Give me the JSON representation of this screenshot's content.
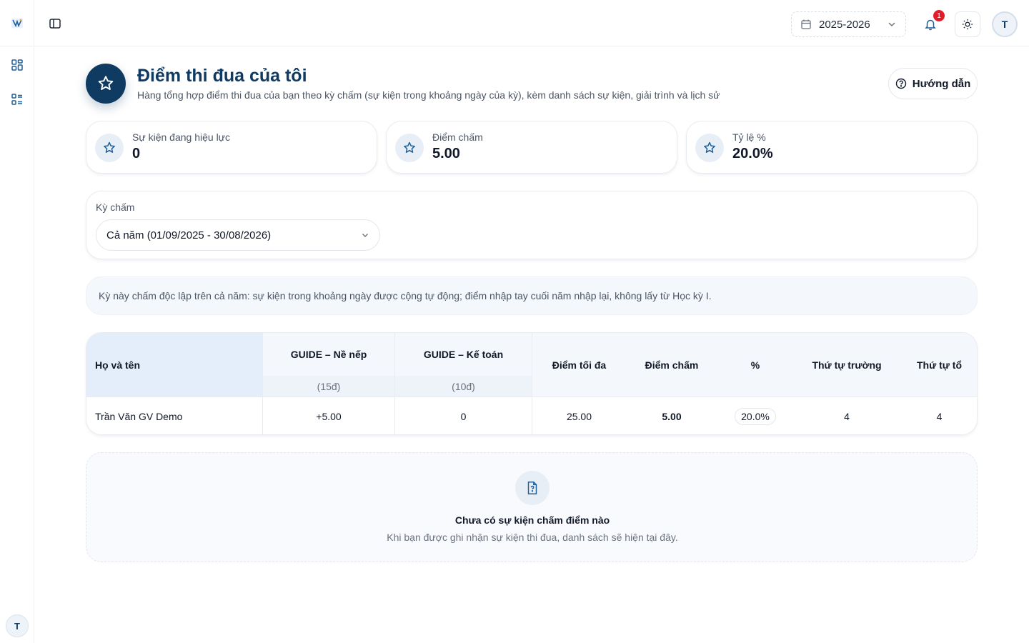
{
  "header": {
    "school_year": "2025-2026",
    "notification_count": "1",
    "user_initial": "T"
  },
  "sidebar": {
    "user_initial": "T",
    "icons": [
      "app-logo-icon",
      "dashboard-grid-icon",
      "list-icon"
    ]
  },
  "page": {
    "title": "Điểm thi đua của tôi",
    "subtitle": "Hàng tổng hợp điểm thi đua của bạn theo kỳ chấm (sự kiện trong khoảng ngày của kỳ), kèm danh sách sự kiện, giải trình và lịch sử",
    "guide_label": "Hướng dẫn"
  },
  "stats": [
    {
      "label": "Sự kiện đang hiệu lực",
      "value": "0"
    },
    {
      "label": "Điểm chấm",
      "value": "5.00"
    },
    {
      "label": "Tỷ lệ %",
      "value": "20.0%"
    }
  ],
  "period": {
    "label": "Kỳ chấm",
    "selected": "Cả năm (01/09/2025 - 30/08/2026)"
  },
  "note": "Kỳ này chấm độc lập trên cả năm: sự kiện trong khoảng ngày được cộng tự động; điểm nhập tay cuối năm nhập lại, không lấy từ Học kỳ I.",
  "table": {
    "headers": {
      "name": "Họ và tên",
      "guide1": "GUIDE – Nề nếp",
      "guide1_sub": "(15đ)",
      "guide2": "GUIDE – Kế toán",
      "guide2_sub": "(10đ)",
      "max": "Điểm tối đa",
      "score": "Điểm chấm",
      "pct": "%",
      "rank_school": "Thứ tự trường",
      "rank_group": "Thứ tự tổ"
    },
    "rows": [
      {
        "name": "Trần Văn GV Demo",
        "guide1": "+5.00",
        "guide2": "0",
        "max": "25.00",
        "score": "5.00",
        "pct": "20.0%",
        "rank_school": "4",
        "rank_group": "4"
      }
    ]
  },
  "empty": {
    "title": "Chưa có sự kiện chấm điểm nào",
    "text": "Khi bạn được ghi nhận sự kiện thi đua, danh sách sẽ hiện tại đây."
  }
}
